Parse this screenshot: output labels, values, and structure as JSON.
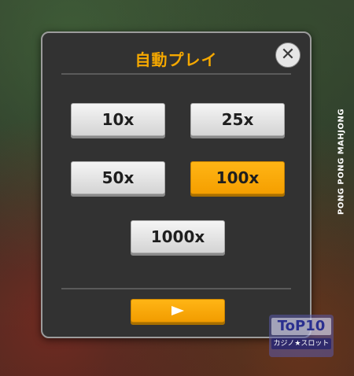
{
  "dialog": {
    "title": "自動プレイ",
    "close_glyph": "✕",
    "options": [
      {
        "label": "10x",
        "selected": false
      },
      {
        "label": "25x",
        "selected": false
      },
      {
        "label": "50x",
        "selected": false
      },
      {
        "label": "100x",
        "selected": true
      },
      {
        "label": "1000x",
        "selected": false
      }
    ],
    "play_icon": "play-icon"
  },
  "side_title": "PONG PONG MAHJONG",
  "watermark": {
    "logo": "ToP10",
    "subtitle": "カジノ★スロット"
  },
  "colors": {
    "accent": "#f5a800",
    "panel": "#323232",
    "button_light": "#e6e6e6"
  }
}
